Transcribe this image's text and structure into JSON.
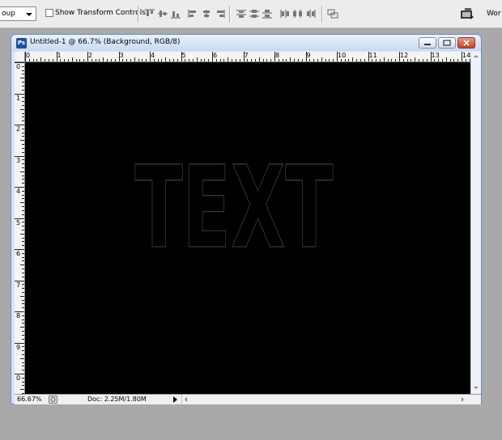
{
  "options_bar": {
    "mode_select_value": "oup",
    "show_transform_controls": "Show Transform Controls",
    "workspace_label": "Wor"
  },
  "document": {
    "title": "Untitled-1 @ 66.7% (Background, RGB/8)",
    "app_icon": "Ps",
    "ruler_h": [
      "0",
      "1",
      "2",
      "3",
      "4",
      "5",
      "6",
      "7",
      "8",
      "9",
      "10",
      "11",
      "12",
      "13",
      "14"
    ],
    "ruler_v": [
      "0",
      "1",
      "2",
      "3",
      "4",
      "5",
      "6",
      "7",
      "8",
      "9",
      "0"
    ],
    "canvas_text": "TEXT"
  },
  "status_bar": {
    "zoom": "66.67%",
    "doc_info": "Doc: 2.25M/1.80M"
  },
  "colors": {
    "canvas": "#000000",
    "title_bar": "#c9d9f0",
    "close_button": "#c7402a"
  }
}
